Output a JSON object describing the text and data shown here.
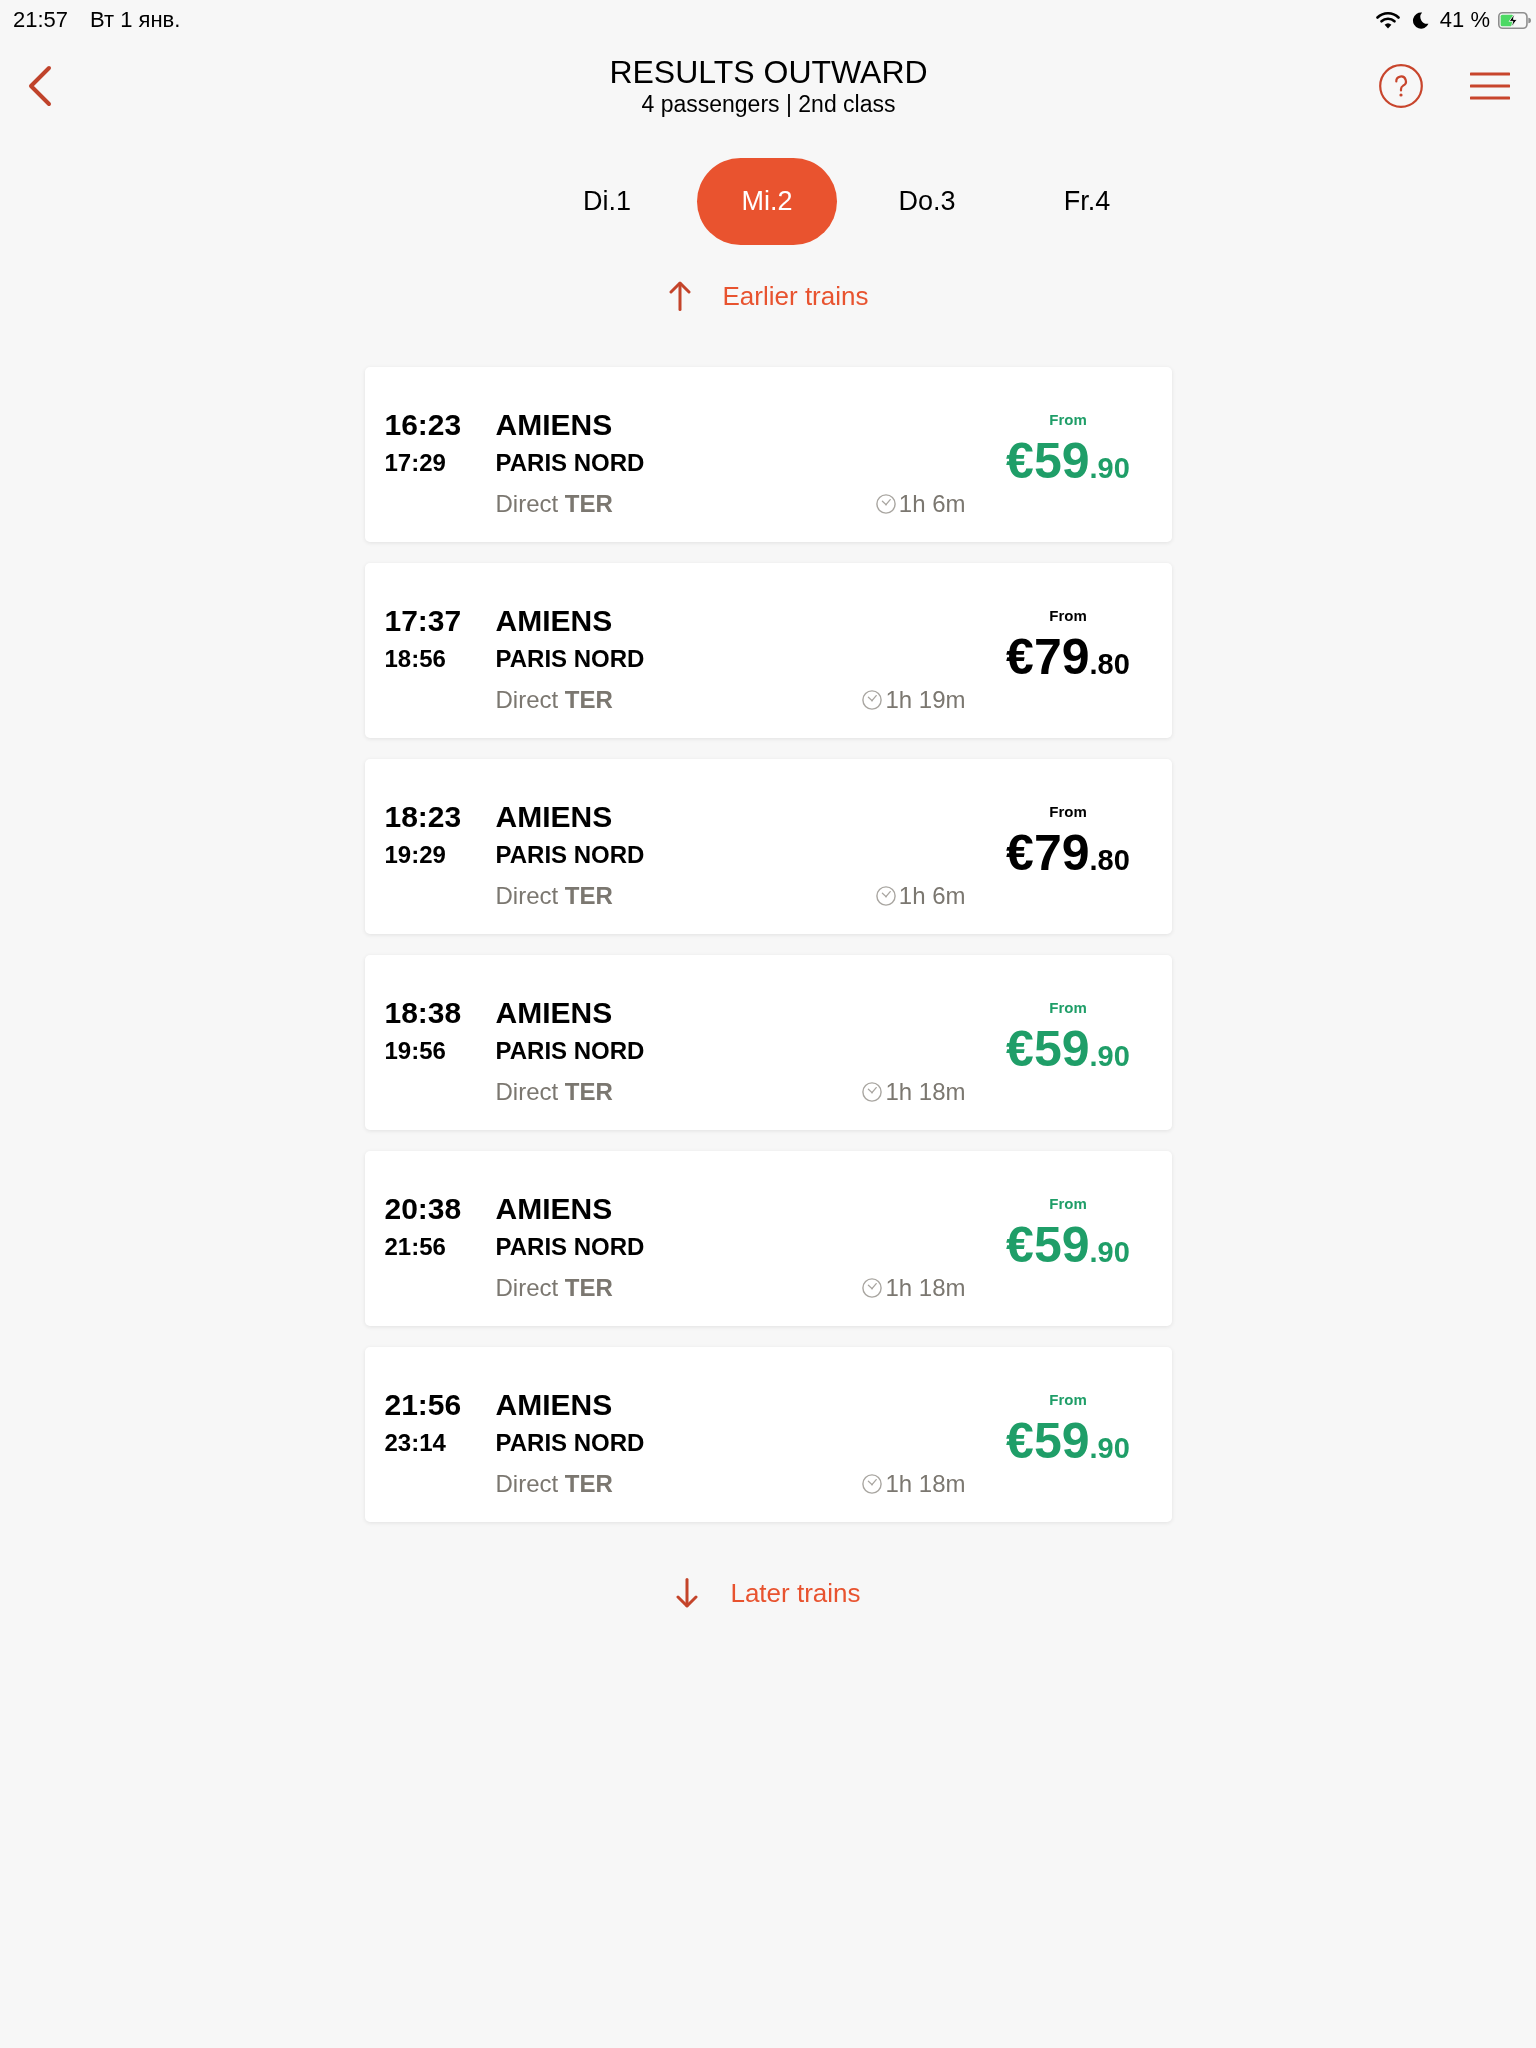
{
  "status_bar": {
    "time": "21:57",
    "date": "Вт 1 янв.",
    "battery_percent": "41 %"
  },
  "header": {
    "title": "RESULTS OUTWARD",
    "subtitle": "4 passengers | 2nd class"
  },
  "day_tabs": [
    {
      "label": "Di.1",
      "selected": false
    },
    {
      "label": "Mi.2",
      "selected": true
    },
    {
      "label": "Do.3",
      "selected": false
    },
    {
      "label": "Fr.4",
      "selected": false
    }
  ],
  "earlier_trains": {
    "label": "Earlier trains"
  },
  "trains": [
    {
      "departure": "16:23",
      "arrival": "17:29",
      "origin": "AMIENS",
      "destination": "PARIS NORD",
      "service": "Direct **TER**",
      "duration": "1h 6m",
      "price_label": "From",
      "price": "€59",
      "price_cents": ".90",
      "best_price": true
    },
    {
      "departure": "17:37",
      "arrival": "18:56",
      "origin": "AMIENS",
      "destination": "PARIS NORD",
      "service": "Direct **TER**",
      "duration": "1h 19m",
      "price_label": "From",
      "price": "€79",
      "price_cents": ".80",
      "best_price": false
    },
    {
      "departure": "18:23",
      "arrival": "19:29",
      "origin": "AMIENS",
      "destination": "PARIS NORD",
      "service": "Direct **TER**",
      "duration": "1h 6m",
      "price_label": "From",
      "price": "€79",
      "price_cents": ".80",
      "best_price": false
    },
    {
      "departure": "18:38",
      "arrival": "19:56",
      "origin": "AMIENS",
      "destination": "PARIS NORD",
      "service": "Direct **TER**",
      "duration": "1h 18m",
      "price_label": "From",
      "price": "€59",
      "price_cents": ".90",
      "best_price": true
    },
    {
      "departure": "20:38",
      "arrival": "21:56",
      "origin": "AMIENS",
      "destination": "PARIS NORD",
      "service": "Direct **TER**",
      "duration": "1h 18m",
      "price_label": "From",
      "price": "€59",
      "price_cents": ".90",
      "best_price": true
    },
    {
      "departure": "21:56",
      "arrival": "23:14",
      "origin": "AMIENS",
      "destination": "PARIS NORD",
      "service": "Direct **TER**",
      "duration": "1h 18m",
      "price_label": "From",
      "price": "€59",
      "price_cents": ".90",
      "best_price": true
    }
  ],
  "later_trains": {
    "label": "Later trains"
  }
}
